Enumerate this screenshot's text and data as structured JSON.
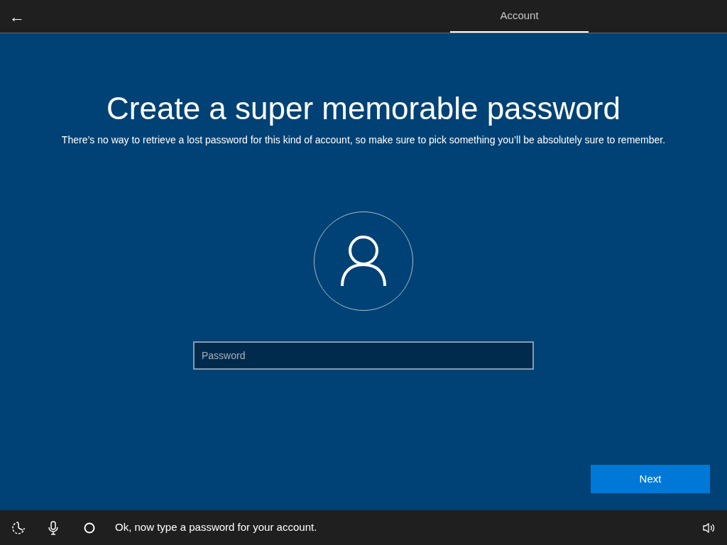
{
  "header": {
    "back": "←",
    "tabs": [
      {
        "label": "Account",
        "selected": true
      }
    ]
  },
  "title": "Create a super memorable password",
  "subtitle": "There’s no way to retrieve a lost password for this kind of account, so make sure to pick something you’ll be absolutely sure to remember.",
  "password": {
    "placeholder": "Password"
  },
  "next_button": "Next",
  "status_bar": {
    "message": "Ok, now type a password for your account."
  }
}
